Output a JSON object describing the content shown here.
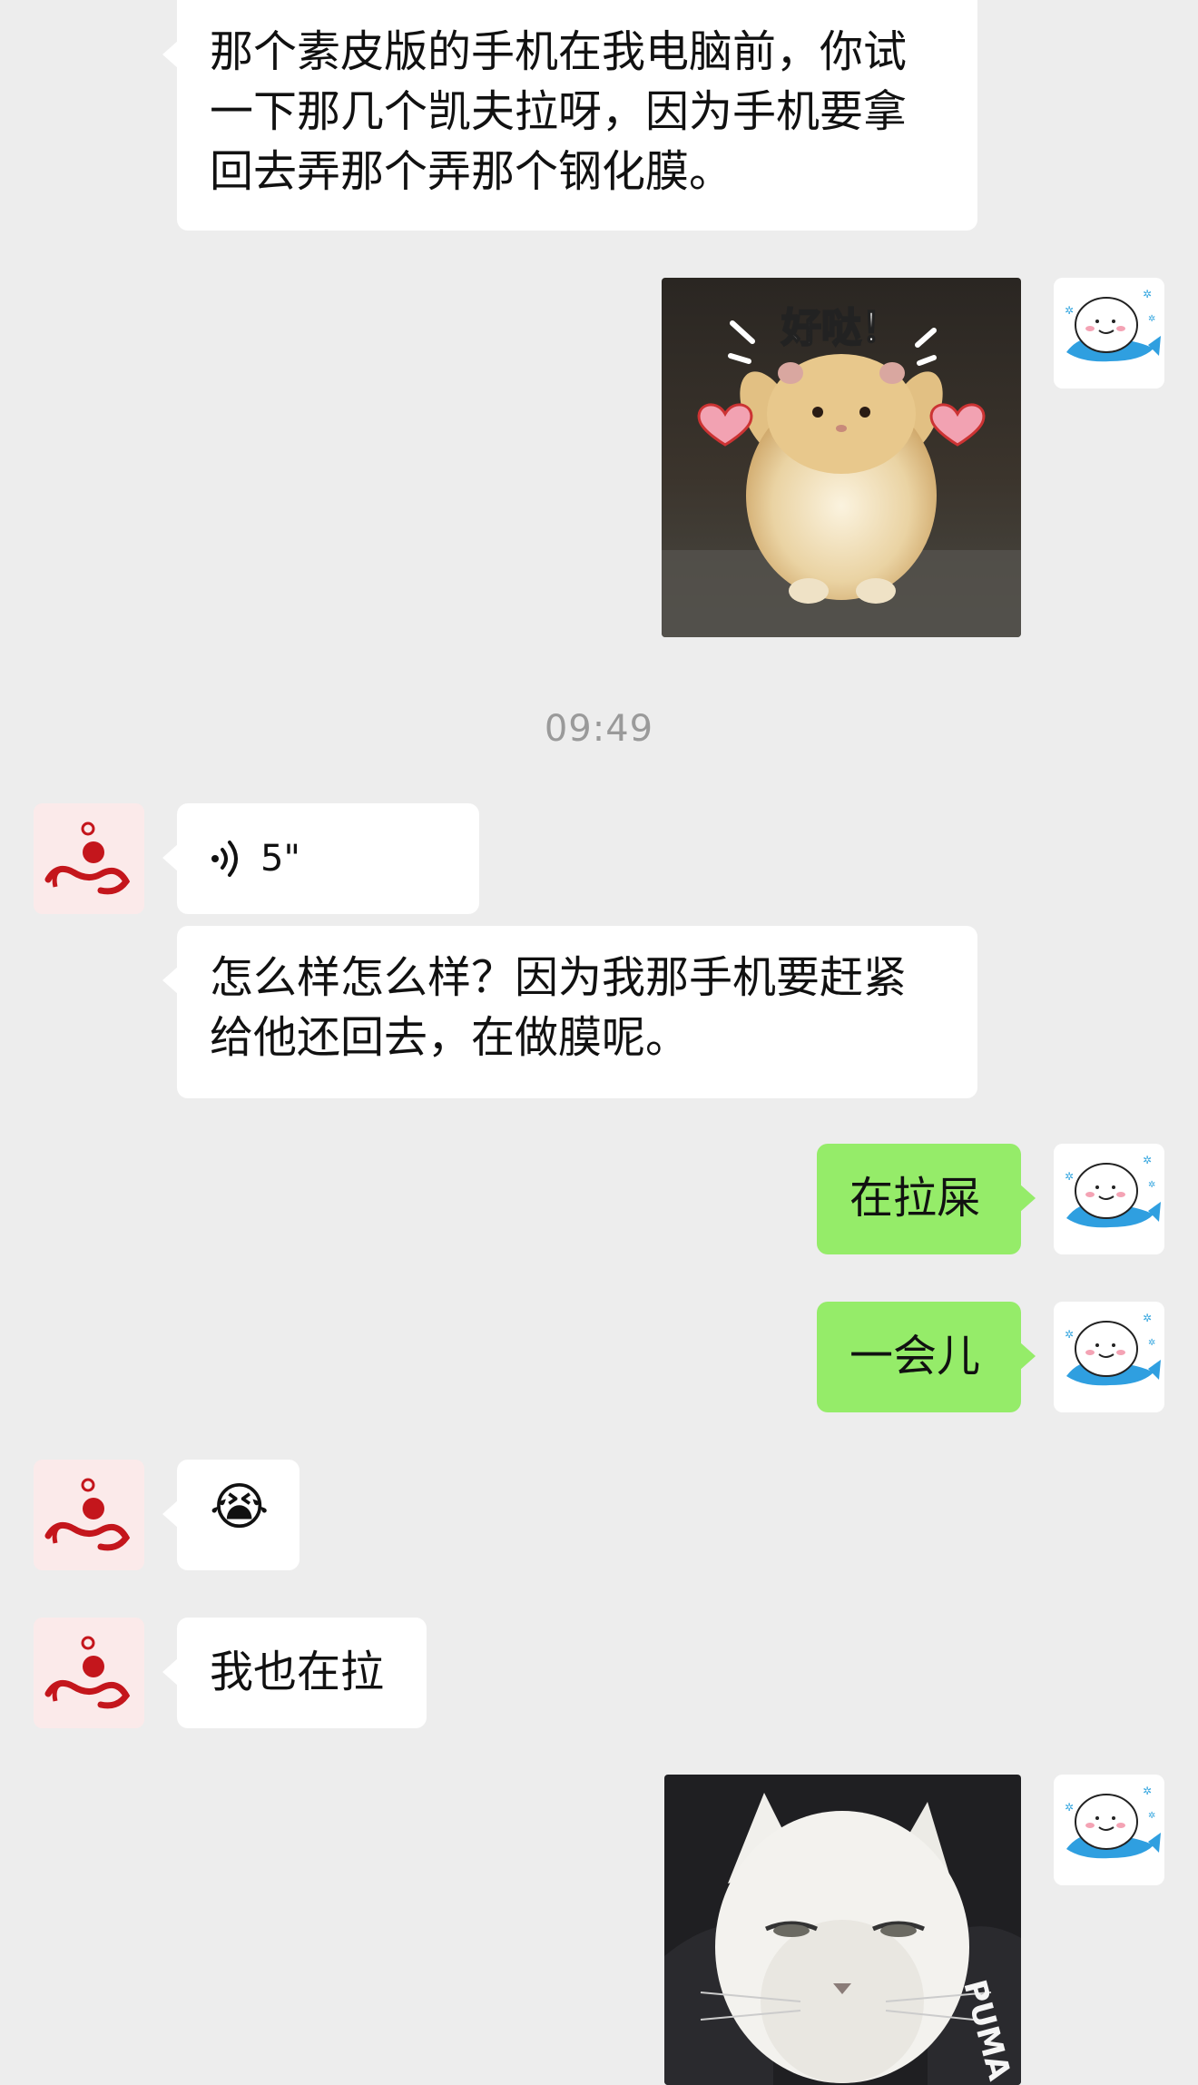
{
  "messages": [
    {
      "id": "m1",
      "side": "left",
      "type": "text",
      "text": "那个素皮版的手机在我电脑前，你试一下那几个凯夫拉呀，因为手机要拿回去弄那个弄那个钢化膜。"
    },
    {
      "id": "m2",
      "side": "right",
      "type": "sticker",
      "caption": "好哒！"
    },
    {
      "id": "m3",
      "side": "left",
      "type": "voice",
      "duration": "5\""
    },
    {
      "id": "m4",
      "side": "left",
      "type": "text",
      "text": "怎么样怎么样？因为我那手机要赶紧给他还回去，在做膜呢。"
    },
    {
      "id": "m5",
      "side": "right",
      "type": "text",
      "text": "在拉屎"
    },
    {
      "id": "m6",
      "side": "right",
      "type": "text",
      "text": "一会儿"
    },
    {
      "id": "m7",
      "side": "left",
      "type": "emoji",
      "emoji": "😭"
    },
    {
      "id": "m8",
      "side": "left",
      "type": "text",
      "text": "我也在拉"
    },
    {
      "id": "m9",
      "side": "right",
      "type": "sticker",
      "caption": "PUMA"
    }
  ],
  "timestamp": "09:49",
  "colors": {
    "background": "#ededed",
    "incoming_bubble": "#ffffff",
    "outgoing_bubble": "#95ec69",
    "timestamp_text": "#9a9a9a"
  },
  "icons": {
    "self_avatar": "white-blob-on-blue-fish-icon",
    "contact_avatar": "red-seal-logo-icon",
    "voice": "voice-waves-icon"
  }
}
